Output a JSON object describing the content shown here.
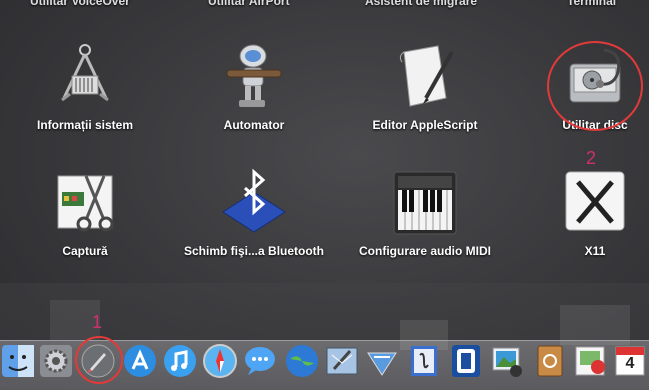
{
  "top_row_cutoff": [
    "Utilitar VoiceOver",
    "Utilitar AirPort",
    "Asistent de migrare",
    "Terminal"
  ],
  "apps": [
    {
      "label": "Informații sistem",
      "icon": "system-information-icon"
    },
    {
      "label": "Automator",
      "icon": "automator-robot-icon"
    },
    {
      "label": "Editor AppleScript",
      "icon": "applescript-editor-icon"
    },
    {
      "label": "Utilitar disc",
      "icon": "disk-utility-icon"
    },
    {
      "label": "Captură",
      "icon": "grab-icon"
    },
    {
      "label": "Schimb fişi...a Bluetooth",
      "icon": "bluetooth-icon"
    },
    {
      "label": "Configurare audio MIDI",
      "icon": "midi-keyboard-icon"
    },
    {
      "label": "X11",
      "icon": "x11-icon"
    }
  ],
  "annotations": {
    "dock_number": "1",
    "grid_number": "2"
  },
  "dock": [
    "finder-icon",
    "system-preferences-icon",
    "launchpad-icon",
    "app-store-icon",
    "itunes-icon",
    "safari-icon",
    "messages-icon",
    "globe-icon",
    "mail-icon",
    "network-icon",
    "pages-icon",
    "utility-icon",
    "photos-icon",
    "address-book-icon",
    "preview-icon",
    "calendar-icon"
  ],
  "calendar_day": "4",
  "colors": {
    "annotation_circle": "#e23a3a",
    "annotation_number": "#d0306a"
  }
}
